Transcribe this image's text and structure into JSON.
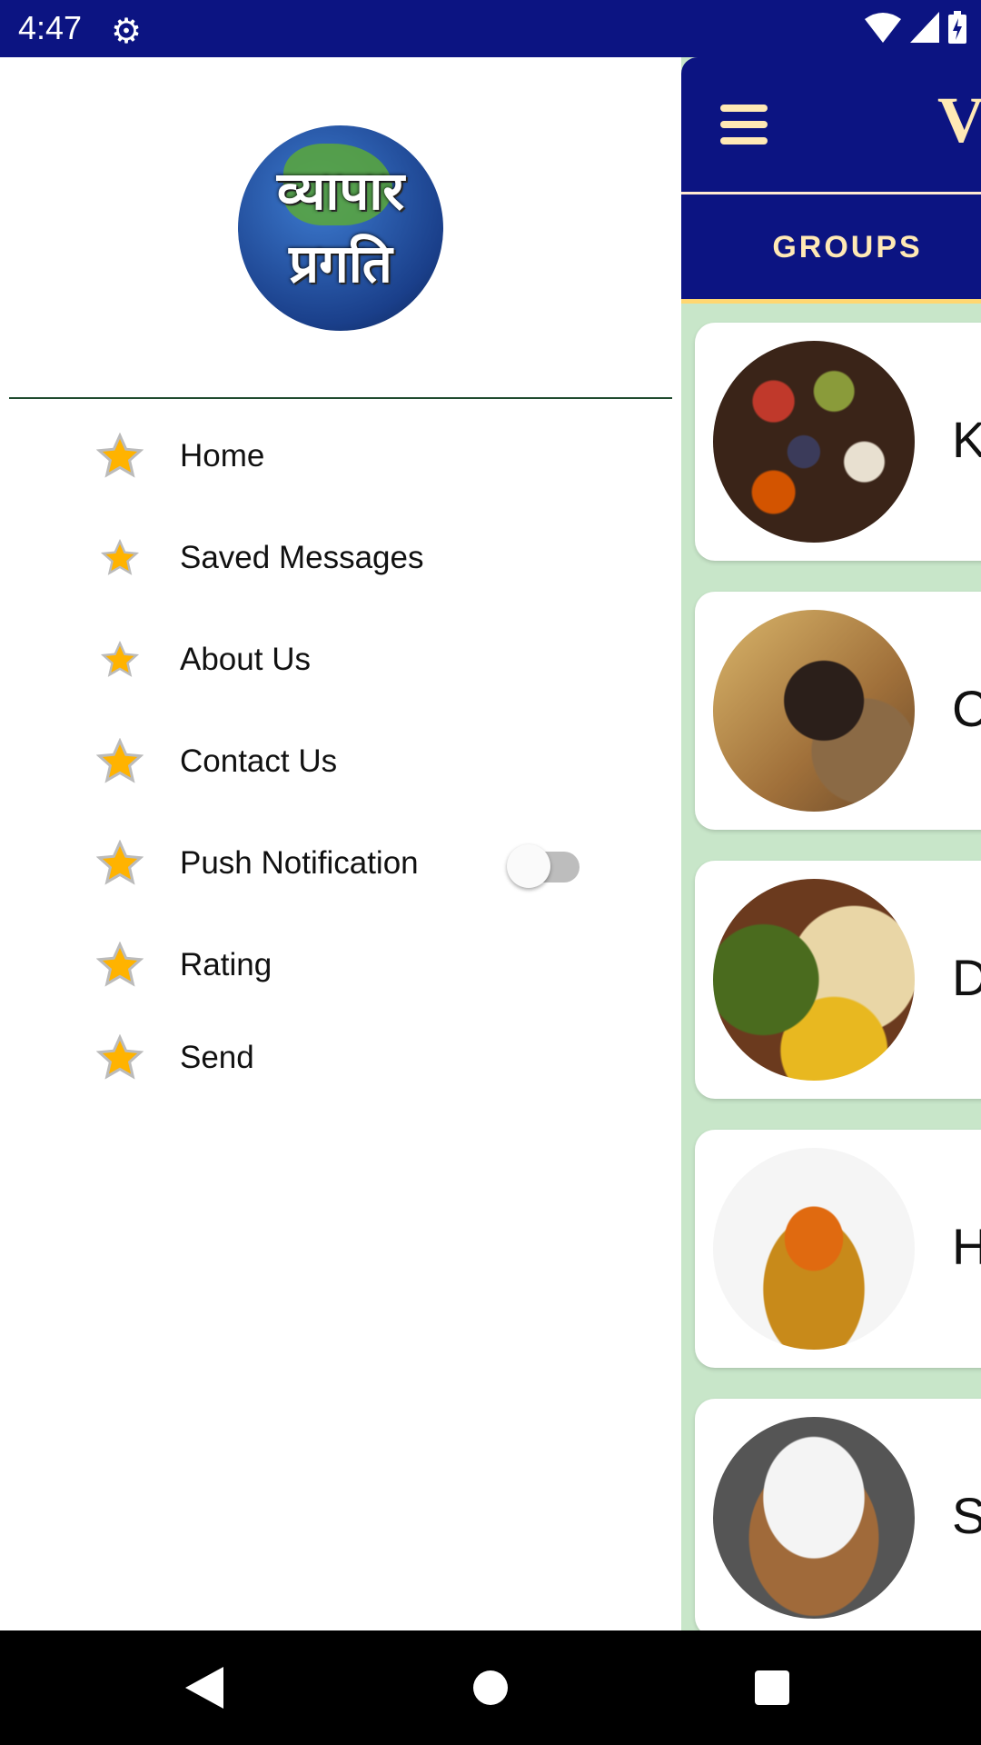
{
  "status_bar": {
    "time": "4:47",
    "icons": [
      "settings-gear-icon",
      "wifi-icon",
      "signal-icon",
      "battery-charging-icon"
    ]
  },
  "app_bar": {
    "title": "V",
    "menu_icon": "hamburger-menu-icon"
  },
  "tabs": [
    {
      "label": "GROUPS",
      "selected": true
    }
  ],
  "colors": {
    "primary": "#0c1482",
    "accent": "#ffe9b5",
    "indicator": "#ffd771",
    "background": "#c8e6c9"
  },
  "groups": [
    {
      "name": "K",
      "image": "spices"
    },
    {
      "name": "C",
      "image": "grains"
    },
    {
      "name": "D",
      "image": "pulses"
    },
    {
      "name": "H",
      "image": "turmeric"
    },
    {
      "name": "S",
      "image": "salt-sugar"
    }
  ],
  "drawer": {
    "logo_text": [
      "व्यापार",
      "प्रगति"
    ],
    "items": [
      {
        "label": "Home",
        "icon": "star-icon"
      },
      {
        "label": "Saved Messages",
        "icon": "star-icon"
      },
      {
        "label": "About Us",
        "icon": "star-icon"
      },
      {
        "label": "Contact Us",
        "icon": "star-icon"
      },
      {
        "label": "Push Notification",
        "icon": "star-icon",
        "toggle": false
      },
      {
        "label": "Rating",
        "icon": "star-icon"
      },
      {
        "label": "Send",
        "icon": "star-icon"
      }
    ]
  },
  "nav_bar": {
    "buttons": [
      "back-icon",
      "home-icon",
      "recents-icon"
    ]
  }
}
